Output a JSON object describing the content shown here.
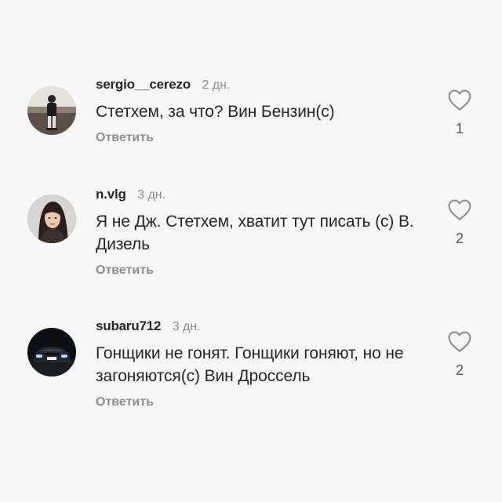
{
  "comments": [
    {
      "username": "sergio__cerezo",
      "time": "2 дн.",
      "text": "Стетхем, за что? Вин Бензин(с)",
      "reply_label": "Ответить",
      "likes": "1",
      "avatar_icon": "person-standing-avatar"
    },
    {
      "username": "n.vlg",
      "time": "3 дн.",
      "text": "Я не Дж. Стетхем, хватит тут писать (с) В. Дизель",
      "reply_label": "Ответить",
      "likes": "2",
      "avatar_icon": "woman-portrait-avatar"
    },
    {
      "username": "subaru712",
      "time": "3 дн.",
      "text": "Гонщики не гонят. Гонщики гоняют, но не загоняются(с) Вин Дроссель",
      "reply_label": "Ответить",
      "likes": "2",
      "avatar_icon": "car-avatar"
    }
  ],
  "colors": {
    "background": "#f7f7f7",
    "text": "#262626",
    "muted": "#8e8e8e"
  }
}
